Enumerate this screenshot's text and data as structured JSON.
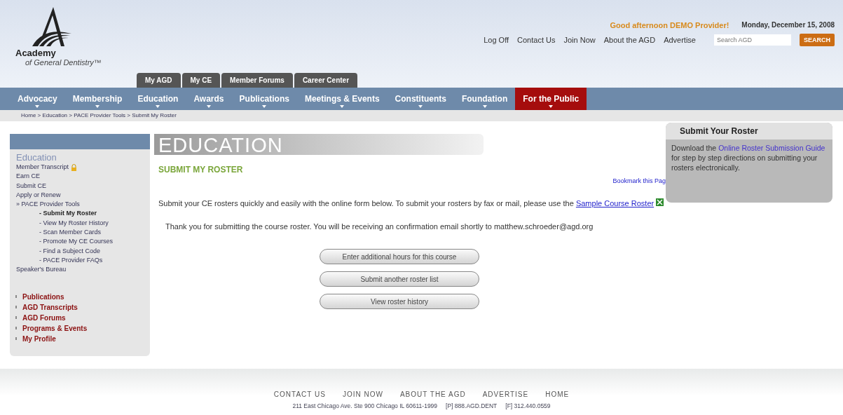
{
  "logo": {
    "name": "Academy",
    "subtitle": "of General Dentistry™"
  },
  "greeting": "Good afternoon DEMO Provider!",
  "date": "Monday, December 15, 2008",
  "top_links": [
    "Log Off",
    "Contact Us",
    "Join Now",
    "About the AGD",
    "Advertise"
  ],
  "search": {
    "placeholder": "Search AGD",
    "button": "SEARCH"
  },
  "tabs": [
    "My AGD",
    "My CE",
    "Member Forums",
    "Career Center"
  ],
  "nav": [
    {
      "label": "Advocacy",
      "selected": false
    },
    {
      "label": "Membership",
      "selected": false
    },
    {
      "label": "Education",
      "selected": false
    },
    {
      "label": "Awards",
      "selected": false
    },
    {
      "label": "Publications",
      "selected": false
    },
    {
      "label": "Meetings & Events",
      "selected": false
    },
    {
      "label": "Constituents",
      "selected": false
    },
    {
      "label": "Foundation",
      "selected": false
    },
    {
      "label": "For the Public",
      "selected": true
    }
  ],
  "breadcrumb": "Home > Education > PACE Provider Tools > Submit My Roster",
  "sidebar": {
    "heading": "Education",
    "items": [
      {
        "label": "Member Transcript",
        "locked": true,
        "selected": false
      },
      {
        "label": "Earn CE",
        "locked": false,
        "selected": false
      },
      {
        "label": "Submit CE",
        "locked": false,
        "selected": false
      },
      {
        "label": "Apply or Renew",
        "locked": false,
        "selected": false
      },
      {
        "label": "» PACE Provider Tools",
        "locked": false,
        "selected": false,
        "children": [
          {
            "label": "- Submit My Roster",
            "selected": true
          },
          {
            "label": "- View My Roster History",
            "selected": false
          },
          {
            "label": "- Scan Member Cards",
            "selected": false
          },
          {
            "label": "- Promote My CE Courses",
            "selected": false
          },
          {
            "label": "- Find a Subject Code",
            "selected": false
          },
          {
            "label": "- PACE Provider FAQs",
            "selected": false
          }
        ]
      },
      {
        "label": "Speaker's Bureau",
        "locked": false,
        "selected": false
      }
    ],
    "links": [
      "Publications",
      "AGD Transcripts",
      "AGD Forums",
      "Programs & Events",
      "My Profile"
    ]
  },
  "banner": "EDUCATION",
  "page_title": "SUBMIT MY ROSTER",
  "bookmark": "Bookmark this Pag",
  "intro": {
    "text": "Submit your CE rosters quickly and easily with the online form below. To submit your rosters by fax or mail, please use the ",
    "link": "Sample Course Roster"
  },
  "confirmation": "Thank you for submitting the course roster. You will be receiving an confirmation email shortly to matthew.schroeder@agd.org",
  "buttons": [
    "Enter additional hours for this course",
    "Submit another roster list",
    "View roster history"
  ],
  "side_box": {
    "title": "Submit Your Roster",
    "before": "Download the ",
    "link": "Online Roster Submission Guide",
    "after": " for step by step directions on submitting your rosters electronically."
  },
  "footer": {
    "links": [
      "CONTACT US",
      "JOIN NOW",
      "ABOUT THE AGD",
      "ADVERTISE",
      "HOME"
    ],
    "address": "211 East Chicago Ave. Ste 900 Chicago IL 60611-1999",
    "phone": "[P] 888.AGD.DENT",
    "fax": "[F] 312.440.0559"
  }
}
